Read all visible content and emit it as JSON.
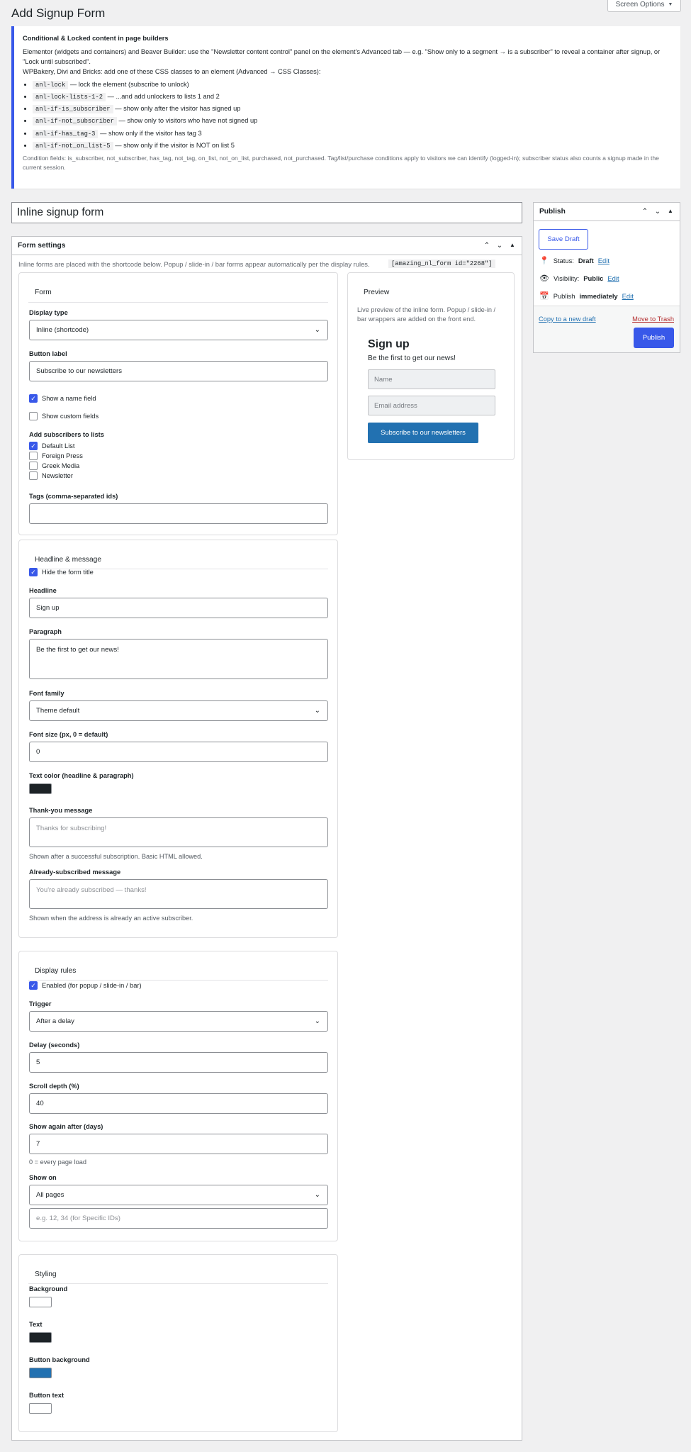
{
  "page": {
    "title": "Add Signup Form",
    "screen_options": "Screen Options",
    "screen_options_arrow": "▼"
  },
  "notice": {
    "title": "Conditional & Locked content in page builders",
    "line1": "Elementor (widgets and containers) and Beaver Builder: use the \"Newsletter content control\" panel on the element's Advanced tab — e.g. \"Show only to a segment → is a subscriber\" to reveal a container after signup, or \"Lock until subscribed\".",
    "line2": "WPBakery, Divi and Bricks: add one of these CSS classes to an element (Advanced → CSS Classes):",
    "items": [
      {
        "code": "anl-lock",
        "text": "— lock the element (subscribe to unlock)"
      },
      {
        "code": "anl-lock-lists-1-2",
        "text": "— ...and add unlockers to lists 1 and 2"
      },
      {
        "code": "anl-if-is_subscriber",
        "text": "— show only after the visitor has signed up"
      },
      {
        "code": "anl-if-not_subscriber",
        "text": "— show only to visitors who have not signed up"
      },
      {
        "code": "anl-if-has_tag-3",
        "text": "— show only if the visitor has tag 3"
      },
      {
        "code": "anl-if-not_on_list-5",
        "text": "— show only if the visitor is NOT on list 5"
      }
    ],
    "fine": "Condition fields: is_subscriber, not_subscriber, has_tag, not_tag, on_list, not_on_list, purchased, not_purchased. Tag/list/purchase conditions apply to visitors we can identify (logged-in); subscriber status also counts a signup made in the current session."
  },
  "post_title": "Inline signup form",
  "form_settings": {
    "title": "Form settings",
    "intro": "Inline forms are placed with the shortcode below. Popup / slide-in / bar forms appear automatically per the display rules.",
    "shortcode": "[amazing_nl_form id=\"2268\"]"
  },
  "form_card": {
    "title": "Form",
    "display_type_label": "Display type",
    "display_type_value": "Inline (shortcode)",
    "button_label_label": "Button label",
    "button_label_value": "Subscribe to our newsletters",
    "show_name": "Show a name field",
    "show_custom": "Show custom fields",
    "lists_label": "Add subscribers to lists",
    "lists": [
      {
        "name": "Default List",
        "checked": true
      },
      {
        "name": "Foreign Press",
        "checked": false
      },
      {
        "name": "Greek Media",
        "checked": false
      },
      {
        "name": "Newsletter",
        "checked": false
      }
    ],
    "tags_label": "Tags (comma-separated ids)",
    "tags_value": ""
  },
  "headline_card": {
    "title": "Headline & message",
    "hide_title": "Hide the form title",
    "headline_label": "Headline",
    "headline_value": "Sign up",
    "paragraph_label": "Paragraph",
    "paragraph_value": "Be the first to get our news!",
    "font_family_label": "Font family",
    "font_family_value": "Theme default",
    "font_size_label": "Font size (px, 0 = default)",
    "font_size_value": "0",
    "text_color_label": "Text color (headline & paragraph)",
    "text_color": "#1d2327",
    "thanks_label": "Thank-you message",
    "thanks_placeholder": "Thanks for subscribing!",
    "thanks_help": "Shown after a successful subscription. Basic HTML allowed.",
    "already_label": "Already-subscribed message",
    "already_placeholder": "You're already subscribed — thanks!",
    "already_help": "Shown when the address is already an active subscriber."
  },
  "display_card": {
    "title": "Display rules",
    "enabled": "Enabled (for popup / slide-in / bar)",
    "trigger_label": "Trigger",
    "trigger_value": "After a delay",
    "delay_label": "Delay (seconds)",
    "delay_value": "5",
    "scroll_label": "Scroll depth (%)",
    "scroll_value": "40",
    "again_label": "Show again after (days)",
    "again_value": "7",
    "again_help": "0 = every page load",
    "show_on_label": "Show on",
    "show_on_value": "All pages",
    "ids_placeholder": "e.g. 12, 34 (for Specific IDs)"
  },
  "styling_card": {
    "title": "Styling",
    "background_label": "Background",
    "background_color": "#ffffff",
    "text_label": "Text",
    "text_color": "#1d2327",
    "button_bg_label": "Button background",
    "button_bg_color": "#2271b1",
    "button_text_label": "Button text",
    "button_text_color": "#ffffff"
  },
  "preview": {
    "title": "Preview",
    "desc": "Live preview of the inline form. Popup / slide-in / bar wrappers are added on the front end.",
    "headline": "Sign up",
    "paragraph": "Be the first to get our news!",
    "name_placeholder": "Name",
    "email_placeholder": "Email address",
    "button": "Subscribe to our newsletters"
  },
  "publish": {
    "title": "Publish",
    "save_draft": "Save Draft",
    "status_label": "Status:",
    "status_value": "Draft",
    "visibility_label": "Visibility:",
    "visibility_value": "Public",
    "publish_label": "Publish",
    "publish_value": "immediately",
    "edit": "Edit",
    "copy": "Copy to a new draft",
    "trash": "Move to Trash",
    "publish_button": "Publish"
  },
  "colors": {
    "accent": "#3858e9",
    "link": "#2271b1",
    "trash": "#b32d2e"
  }
}
